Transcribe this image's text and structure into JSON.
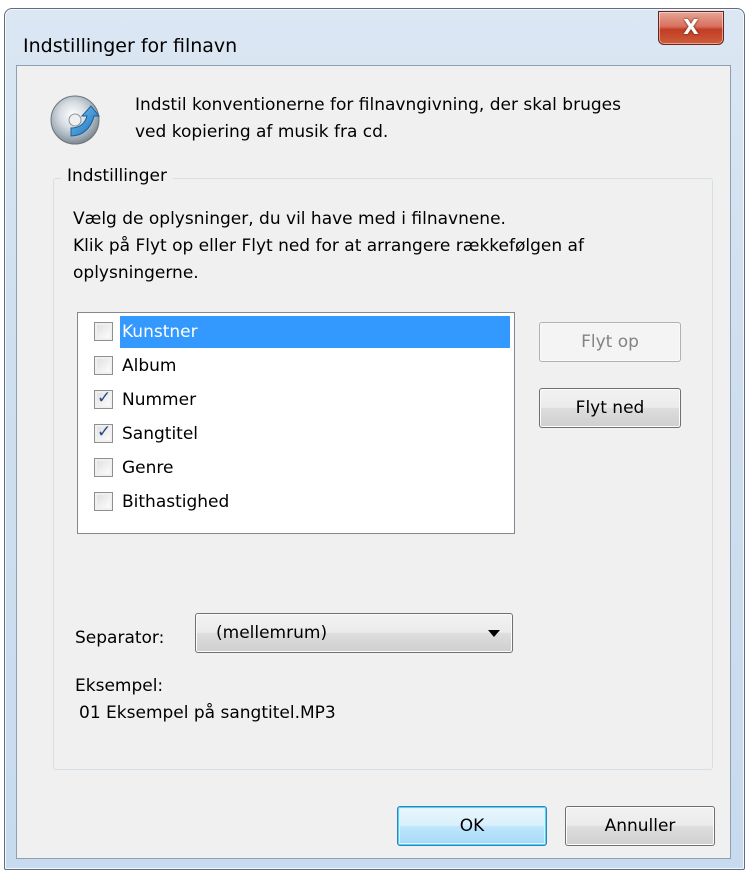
{
  "window": {
    "title": "Indstillinger for filnavn",
    "close_label": "X"
  },
  "header": {
    "icon": "cd-arrow-icon",
    "description_line1": "Indstil konventionerne for filnavngivning, der skal bruges",
    "description_line2": "ved kopiering af musik fra cd."
  },
  "group": {
    "label": "Indstillinger",
    "instruction_line1": "Vælg de oplysninger, du vil have med i filnavnene.",
    "instruction_line2": "Klik på Flyt op eller Flyt ned for at arrangere rækkefølgen af",
    "instruction_line3": "oplysningerne."
  },
  "list": {
    "items": [
      {
        "label": "Kunstner",
        "checked": false,
        "selected": true
      },
      {
        "label": "Album",
        "checked": false,
        "selected": false
      },
      {
        "label": "Nummer",
        "checked": true,
        "selected": false
      },
      {
        "label": "Sangtitel",
        "checked": true,
        "selected": false
      },
      {
        "label": "Genre",
        "checked": false,
        "selected": false
      },
      {
        "label": "Bithastighed",
        "checked": false,
        "selected": false
      }
    ]
  },
  "buttons": {
    "move_up": "Flyt op",
    "move_down": "Flyt ned",
    "ok": "OK",
    "cancel": "Annuller"
  },
  "separator": {
    "label": "Separator:",
    "value": "(mellemrum)"
  },
  "example": {
    "label": "Eksempel:",
    "value": "01 Eksempel på sangtitel.MP3"
  },
  "colors": {
    "selection": "#3399ff",
    "dialog_bg": "#f0f0f0",
    "close_button": "#c84a33"
  }
}
